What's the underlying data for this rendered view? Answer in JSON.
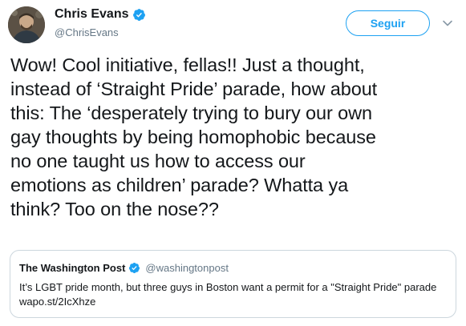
{
  "author": {
    "display_name": "Chris Evans",
    "handle": "@ChrisEvans",
    "avatar_icon": "profile-photo",
    "verified_icon": "verified-badge-icon"
  },
  "follow_button": {
    "label": "Seguir"
  },
  "menu_icon": "chevron-down-icon",
  "tweet": {
    "text": "Wow! Cool initiative, fellas!! Just a thought,\ninstead of ‘Straight Pride’ parade, how about\nthis: The ‘desperately trying to bury our own\ngay thoughts by being homophobic because\nno one taught us how to access our\nemotions as children’ parade? Whatta ya\nthink? Too on the nose??"
  },
  "quoted_tweet": {
    "display_name": "The Washington Post",
    "handle": "@washingtonpost",
    "text": "It’s LGBT pride month, but three guys in Boston want a permit for a \"Straight Pride\" parade wapo.st/2IcXhze"
  },
  "colors": {
    "accent": "#1da1f2",
    "text": "#14171a",
    "secondary_text": "#657786",
    "border": "#ccd6dd"
  }
}
